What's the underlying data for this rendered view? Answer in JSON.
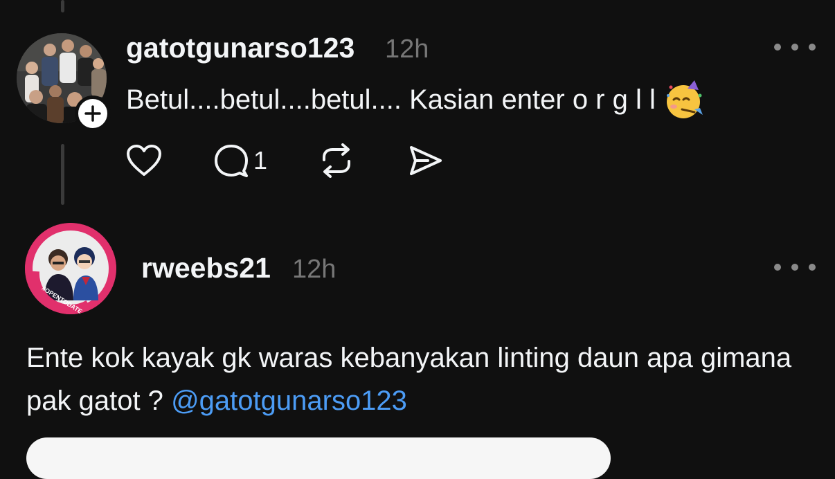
{
  "post1": {
    "username": "gatotgunarso123",
    "time": "12h",
    "text": "Betul....betul....betul.... Kasian enter o r g l l",
    "emoji": "partying-face",
    "reply_count": "1"
  },
  "post2": {
    "username": "rweebs21",
    "time": "12h",
    "avatar_badge_text": "#OPENTODATE",
    "text": "Ente kok kayak gk waras kebanyakan linting daun apa gimana pak gatot ?",
    "mention": "@gatotgunarso123"
  },
  "colors": {
    "background": "#101010",
    "text": "#f3f5f7",
    "muted": "#777777",
    "mention": "#4c9cf5",
    "avatar_ring": "#e1306c"
  }
}
